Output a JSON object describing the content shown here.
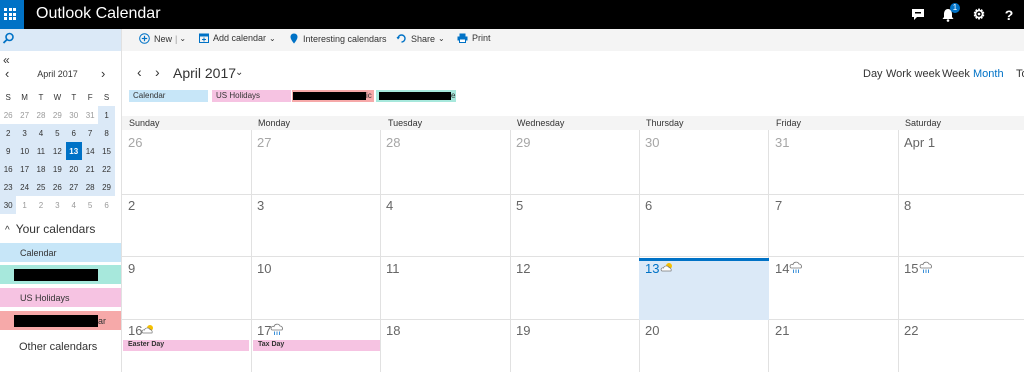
{
  "app": {
    "title": "Outlook Calendar"
  },
  "topbar": {
    "icons": [
      "chat-icon",
      "bell-icon",
      "gear-icon",
      "help-icon"
    ],
    "notification_count": "1",
    "help_glyph": "?"
  },
  "commands": {
    "new_label": "New",
    "add_calendar_label": "Add calendar",
    "interesting_label": "Interesting calendars",
    "share_label": "Share",
    "print_label": "Print"
  },
  "mini_calendar": {
    "month_label": "April 2017",
    "weekday_headers": [
      "S",
      "M",
      "T",
      "W",
      "T",
      "F",
      "S"
    ],
    "weeks": [
      [
        "26",
        "27",
        "28",
        "29",
        "30",
        "31",
        "1"
      ],
      [
        "2",
        "3",
        "4",
        "5",
        "6",
        "7",
        "8"
      ],
      [
        "9",
        "10",
        "11",
        "12",
        "13",
        "14",
        "15"
      ],
      [
        "16",
        "17",
        "18",
        "19",
        "20",
        "21",
        "22"
      ],
      [
        "23",
        "24",
        "25",
        "26",
        "27",
        "28",
        "29"
      ],
      [
        "30",
        "1",
        "2",
        "3",
        "4",
        "5",
        "6"
      ]
    ],
    "today": "13"
  },
  "sidebar": {
    "your_calendars_label": "Your calendars",
    "calendar_label": "Calendar",
    "us_holidays_label": "US Holidays",
    "redacted_suffix": "ar",
    "other_calendars_label": "Other calendars"
  },
  "header": {
    "month_title": "April 2017",
    "views": [
      "Day",
      "Work week",
      "Week",
      "Month",
      "To"
    ],
    "active_view": "Month"
  },
  "chips": {
    "calendar_label": "Calendar",
    "us_holidays_label": "US Holidays",
    "redacted_suffix_1": "ic",
    "redacted_suffix_2": "e"
  },
  "grid": {
    "weekdays": [
      "Sunday",
      "Monday",
      "Tuesday",
      "Wednesday",
      "Thursday",
      "Friday",
      "Saturday"
    ],
    "weeks": [
      [
        "26",
        "27",
        "28",
        "29",
        "30",
        "31",
        "Apr 1"
      ],
      [
        "2",
        "3",
        "4",
        "5",
        "6",
        "7",
        "8"
      ],
      [
        "9",
        "10",
        "11",
        "12",
        "13",
        "14",
        "15"
      ],
      [
        "16",
        "17",
        "18",
        "19",
        "20",
        "21",
        "22"
      ]
    ],
    "today": "13"
  },
  "events": {
    "easter_label": "Easter Day",
    "tax_label": "Tax Day"
  },
  "colors": {
    "accent": "#0072c6",
    "calendar_blue": "#c7e6f8",
    "holiday_pink": "#f6c3e2",
    "teal": "#a7e8dc",
    "red": "#f6a9a9"
  }
}
